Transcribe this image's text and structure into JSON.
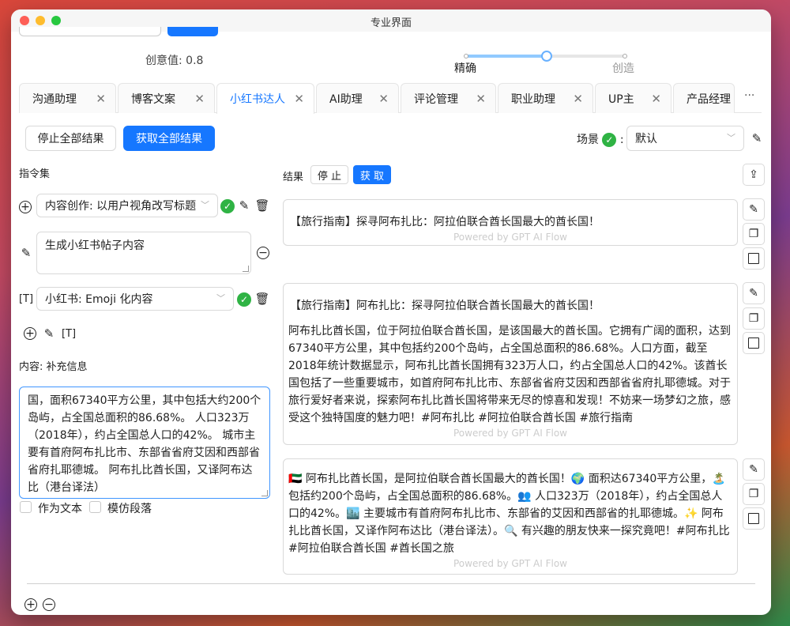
{
  "window": {
    "title": "专业界面"
  },
  "creativity": {
    "label": "创意值: 0.8",
    "value": 0.8,
    "min_label": "精确",
    "max_label": "创造"
  },
  "tabs": [
    {
      "label": "沟通助理"
    },
    {
      "label": "博客文案"
    },
    {
      "label": "小红书达人",
      "active": true
    },
    {
      "label": "AI助理"
    },
    {
      "label": "评论管理"
    },
    {
      "label": "职业助理"
    },
    {
      "label": "UP主"
    },
    {
      "label": "产品经理"
    }
  ],
  "tab_more": "···",
  "toolbar": {
    "stop_all": "停止全部结果",
    "get_all": "获取全部结果",
    "scene_label": "场景",
    "scene_colon": ":",
    "scene_value": "默认"
  },
  "left": {
    "command_set_label": "指令集",
    "command1_select": "内容创作: 以用户视角改写标题",
    "prompt_text": "生成小红书帖子内容",
    "command2_select": "小红书: Emoji 化内容",
    "content_label": "内容: 补充信息",
    "content_text": "国，面积67340平方公里，其中包括大约200个岛屿，占全国总面积的86.68%。 人口323万（2018年），约占全国总人口的42%。 城市主要有首府阿布扎比市、东部省省府艾因和西部省省府扎耶德城。 阿布扎比酋长国，又译阿布达比（港台译法）",
    "as_text": "作为文本",
    "imitate_paragraph": "模仿段落"
  },
  "results": {
    "label": "结果",
    "stop": "停 止",
    "get": "获 取",
    "powered": "Powered by GPT AI Flow",
    "cards": [
      {
        "paragraphs": [
          "【旅行指南】探寻阿布扎比：阿拉伯联合酋长国最大的酋长国！"
        ]
      },
      {
        "paragraphs": [
          "【旅行指南】阿布扎比：探寻阿拉伯联合酋长国最大的酋长国！",
          "阿布扎比酋长国，位于阿拉伯联合酋长国，是该国最大的酋长国。它拥有广阔的面积，达到67340平方公里，其中包括约200个岛屿，占全国总面积的86.68%。人口方面，截至2018年统计数据显示，阿布扎比酋长国拥有323万人口，约占全国总人口的42%。该酋长国包括了一些重要城市，如首府阿布扎比市、东部省省府艾因和西部省省府扎耶德城。对于旅行爱好者来说，探索阿布扎比酋长国将带来无尽的惊喜和发现！不妨来一场梦幻之旅，感受这个独特国度的魅力吧！#阿布扎比 #阿拉伯联合酋长国 #旅行指南"
        ]
      },
      {
        "paragraphs": [
          "🇦🇪 阿布扎比酋长国，是阿拉伯联合酋长国最大的酋长国！🌍 面积达67340平方公里，🏝️ 包括约200个岛屿，占全国总面积的86.68%。👥 人口323万（2018年），约占全国总人口的42%。🏙️ 主要城市有首府阿布扎比市、东部省的艾因和西部省的扎耶德城。✨ 阿布扎比酋长国，又译作阿布达比（港台译法）。🔍 有兴趣的朋友快来一探究竟吧！#阿布扎比 #阿拉伯联合酋长国 #酋长国之旅"
        ]
      }
    ]
  },
  "icons": {
    "check": "✓"
  }
}
